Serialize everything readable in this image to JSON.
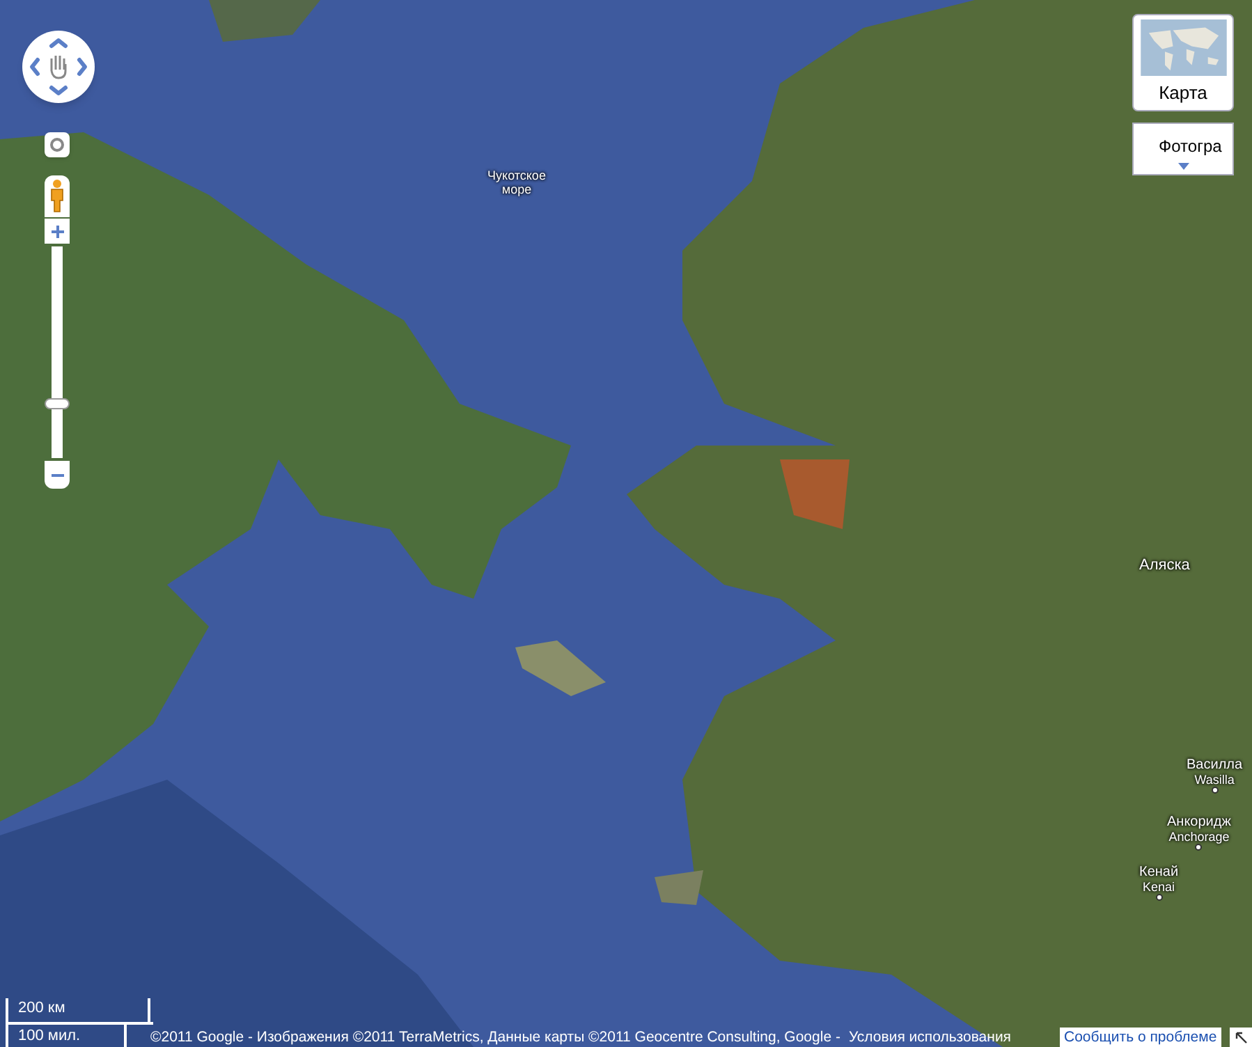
{
  "map_type": {
    "map_button": "Карта",
    "satellite_menu": "Фотогра"
  },
  "zoom": {
    "level": 0.24
  },
  "places": [
    {
      "kind": "sea",
      "name": "Чукотское море"
    },
    {
      "kind": "region",
      "name": "Аляска"
    },
    {
      "kind": "city",
      "name": "Василла",
      "name_en": "Wasilla"
    },
    {
      "kind": "city",
      "name": "Анкоридж",
      "name_en": "Anchorage"
    },
    {
      "kind": "city",
      "name": "Кенай",
      "name_en": "Kenai"
    }
  ],
  "scale": {
    "metric": "200 км",
    "imperial": "100 мил."
  },
  "copyright": "©2011 Google - Изображения ©2011 TerraMetrics, Данные карты ©2011 Geocentre Consulting, Google -",
  "terms_link": "Условия использования",
  "report_link": "Сообщить о проблеме"
}
